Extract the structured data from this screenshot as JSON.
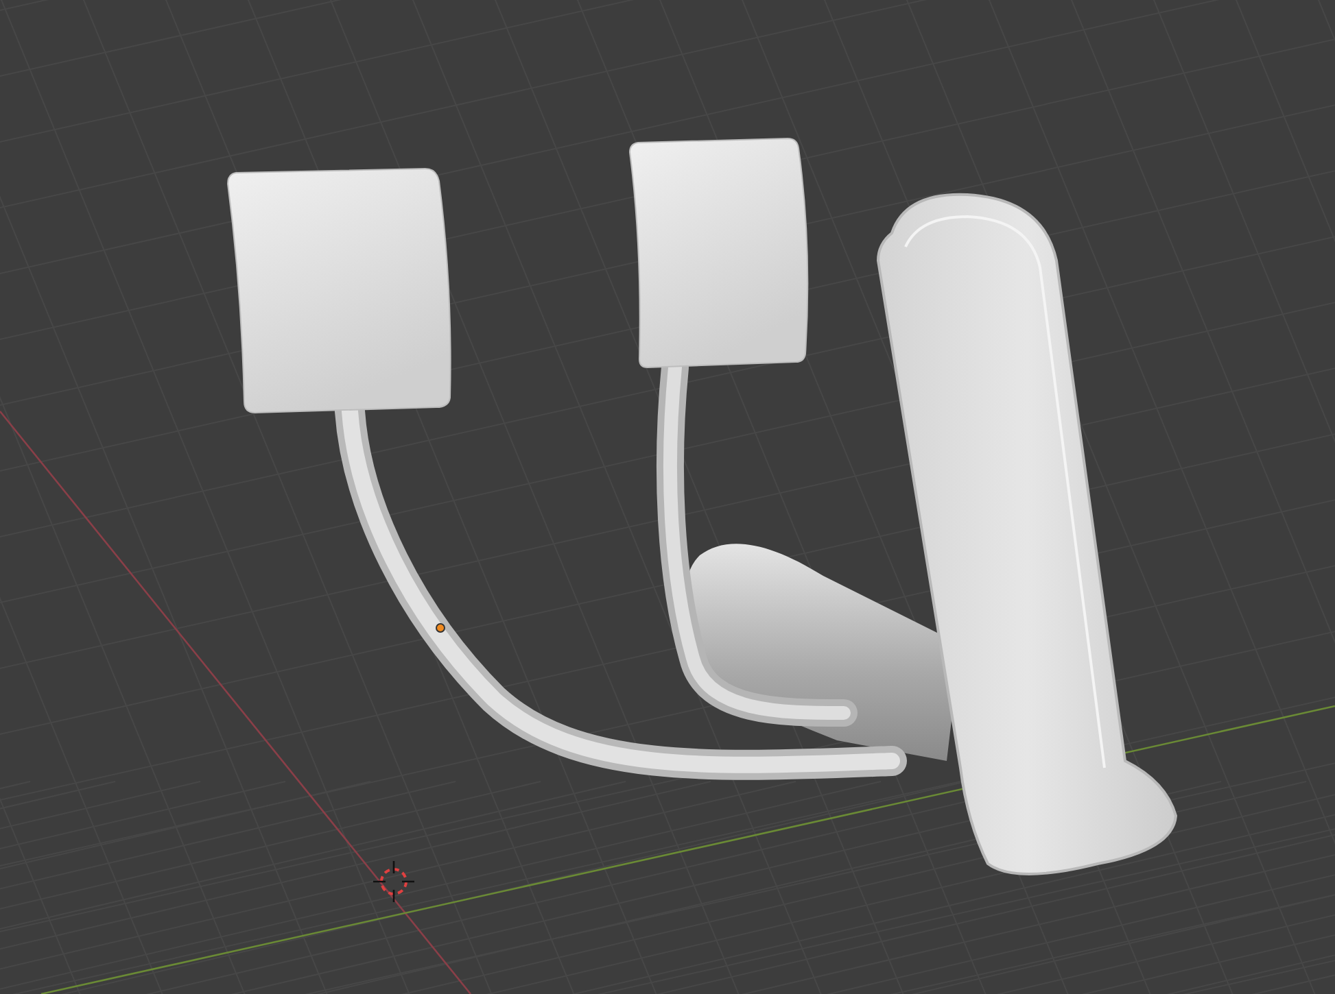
{
  "viewport": {
    "show_grid": true,
    "show_axes": true,
    "show_3d_cursor": true,
    "show_origin": true
  }
}
